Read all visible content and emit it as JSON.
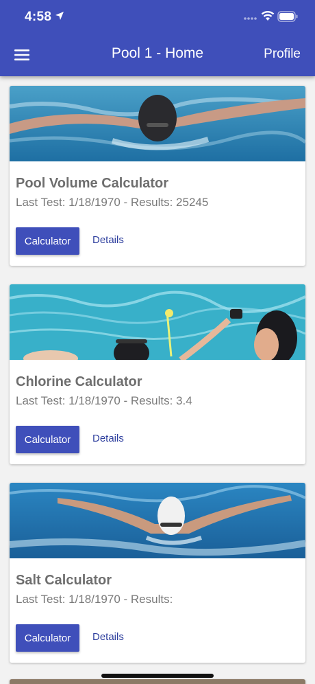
{
  "status_bar": {
    "time": "4:58"
  },
  "header": {
    "title": "Pool 1 - Home",
    "profile_label": "Profile"
  },
  "cards": [
    {
      "title": "Pool Volume Calculator",
      "subtitle": "Last Test: 1/18/1970 - Results: 25245",
      "primary_label": "Calculator",
      "secondary_label": "Details"
    },
    {
      "title": "Chlorine Calculator",
      "subtitle": "Last Test: 1/18/1970 - Results: 3.4",
      "primary_label": "Calculator",
      "secondary_label": "Details"
    },
    {
      "title": "Salt Calculator",
      "subtitle": "Last Test: 1/18/1970 - Results:",
      "primary_label": "Calculator",
      "secondary_label": "Details"
    }
  ],
  "colors": {
    "accent": "#3f4fba",
    "link": "#2e3f9e",
    "water": "#1f8fc7"
  }
}
